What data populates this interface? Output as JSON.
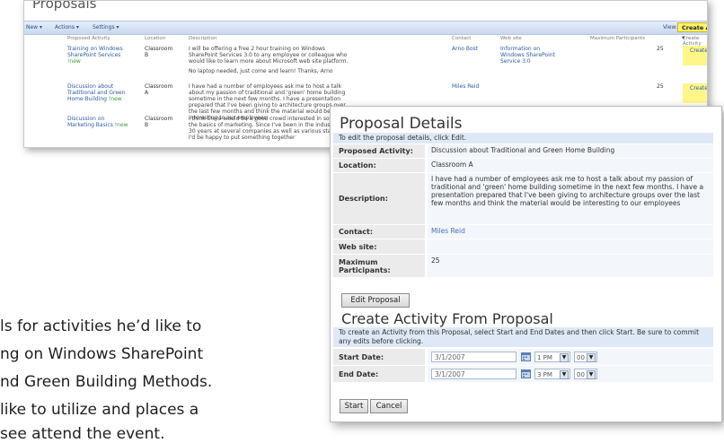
{
  "document": {
    "lines": [
      "ls for activities he’d like to",
      "ng on Windows SharePoint",
      "nd Green Building Methods.",
      "like to utilize and places a",
      "see attend the event."
    ]
  },
  "list_window": {
    "title": "Proposals",
    "toolbar": {
      "new_label": "New ▾",
      "actions_label": "Actions ▾",
      "settings_label": "Settings ▾",
      "view_label": "View:",
      "create_button": "Create Activity from... ▾"
    },
    "columns": [
      "Proposed Activity",
      "Location",
      "Description",
      "Contact",
      "Web site",
      "Maximum Participants",
      "Create Activity"
    ],
    "rows": [
      {
        "title": "Training on Windows SharePoint Services",
        "new": "!new",
        "location": "Classroom B",
        "description": "I will be offering a free 2 hour training on Windows SharePoint Services 3.0 to any employee or colleague who would like to learn more about Microsoft web site platform.",
        "description_2": "No laptop needed, just come and learn! Thanks, Arno",
        "contact": "Arno Bost",
        "website": "Information on Windows SharePoint Service 3.0",
        "max": "25",
        "create": "Create"
      },
      {
        "title": "Discussion about Traditional and Green Home Building",
        "new": "!new",
        "location": "Classroom A",
        "description": "I have had a number of employees ask me to host a talk about my passion of traditional and 'green' home building sometime in the next few months. I have a presentation prepared that I've been giving to architecture groups over the last few months and think the material would be interesting to our employees",
        "contact": "Miles Reid",
        "website": "",
        "max": "25",
        "create": "Create"
      },
      {
        "title": "Discussion on Marketing Basics",
        "new": "!new",
        "location": "Classroom B",
        "description": "I think there would be a good crowd interested in some of the basics of marketing. Since I've been in the industry for 30 years at several companies as well as various startups, I'd be happy to put something together",
        "contact": "",
        "website": "",
        "max": "",
        "create": ""
      }
    ]
  },
  "details_window": {
    "title": "Proposal Details",
    "note": "To edit the proposal details, click Edit.",
    "fields": {
      "activity_label": "Proposed Activity:",
      "activity_value": "Discussion about Traditional and Green Home Building",
      "location_label": "Location:",
      "location_value": "Classroom A",
      "description_label": "Description:",
      "description_value": "I have had a number of employees ask me to host a talk about my passion of traditional and 'green' home building sometime in the next few months.  I have a presentation prepared that I've been giving to architecture groups over the last few months and think the material would be interesting to our employees",
      "contact_label": "Contact:",
      "contact_value": "Miles Reid",
      "website_label": "Web site:",
      "website_value": "",
      "max_label": "Maximum Participants:",
      "max_value": "25"
    },
    "edit_button": "Edit Proposal",
    "create_section": {
      "title": "Create Activity From Proposal",
      "note": "To create an Activity from this Proposal, select Start and End Dates and then click Start. Be sure to commit any edits before clicking.",
      "start_label": "Start Date:",
      "start_date": "3/1/2007",
      "start_hour": "1 PM",
      "start_min": "00",
      "end_label": "End Date:",
      "end_date": "3/1/2007",
      "end_hour": "3 PM",
      "end_min": "00"
    },
    "start_button": "Start",
    "cancel_button": "Cancel"
  }
}
